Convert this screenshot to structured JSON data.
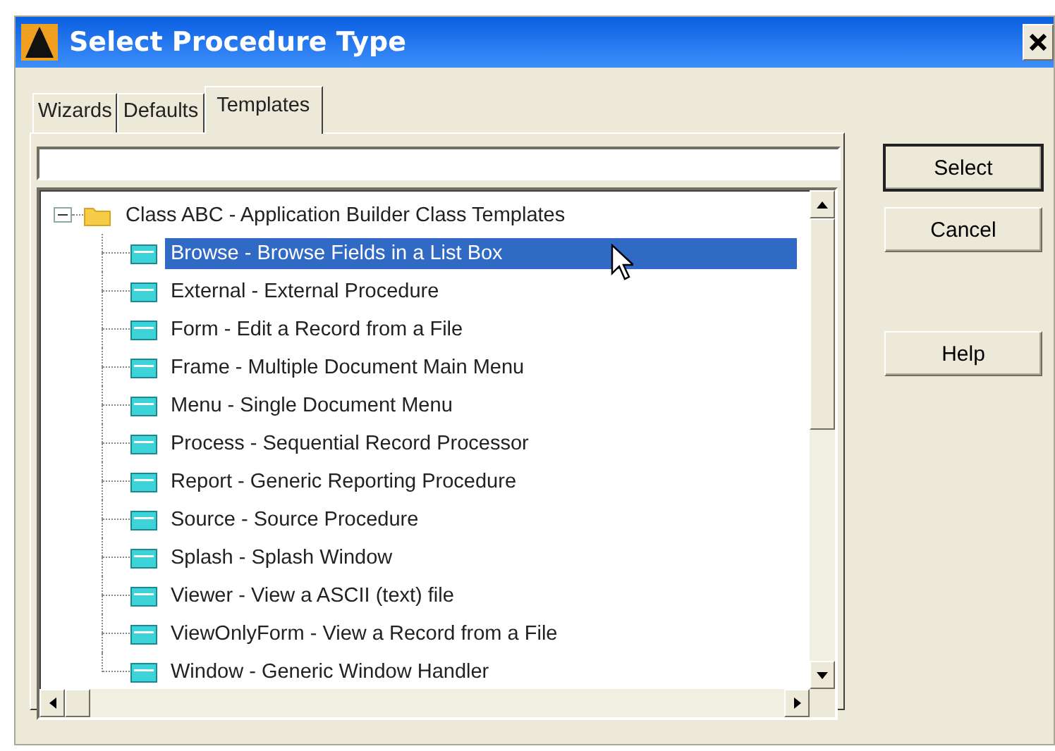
{
  "window": {
    "title": "Select Procedure Type"
  },
  "tabs": [
    {
      "label": "Wizards",
      "selected": false
    },
    {
      "label": "Defaults",
      "selected": false
    },
    {
      "label": "Templates",
      "selected": true
    }
  ],
  "tree": {
    "label": "Class ABC - Application Builder Class Templates",
    "expanded": true,
    "children": [
      {
        "label": "Browse - Browse Fields in a List Box",
        "selected": true
      },
      {
        "label": "External - External Procedure",
        "selected": false
      },
      {
        "label": "Form - Edit a Record from a File",
        "selected": false
      },
      {
        "label": "Frame - Multiple Document Main Menu",
        "selected": false
      },
      {
        "label": "Menu - Single Document Menu",
        "selected": false
      },
      {
        "label": "Process - Sequential Record Processor",
        "selected": false
      },
      {
        "label": "Report - Generic Reporting Procedure",
        "selected": false
      },
      {
        "label": "Source - Source Procedure",
        "selected": false
      },
      {
        "label": "Splash - Splash Window",
        "selected": false
      },
      {
        "label": "Viewer - View a ASCII (text) file",
        "selected": false
      },
      {
        "label": "ViewOnlyForm - View a Record from a File",
        "selected": false
      },
      {
        "label": "Window - Generic Window Handler",
        "selected": false
      }
    ]
  },
  "buttons": [
    {
      "label": "Select",
      "default": true
    },
    {
      "label": "Cancel",
      "default": false
    },
    {
      "label": "Help",
      "default": false
    }
  ]
}
